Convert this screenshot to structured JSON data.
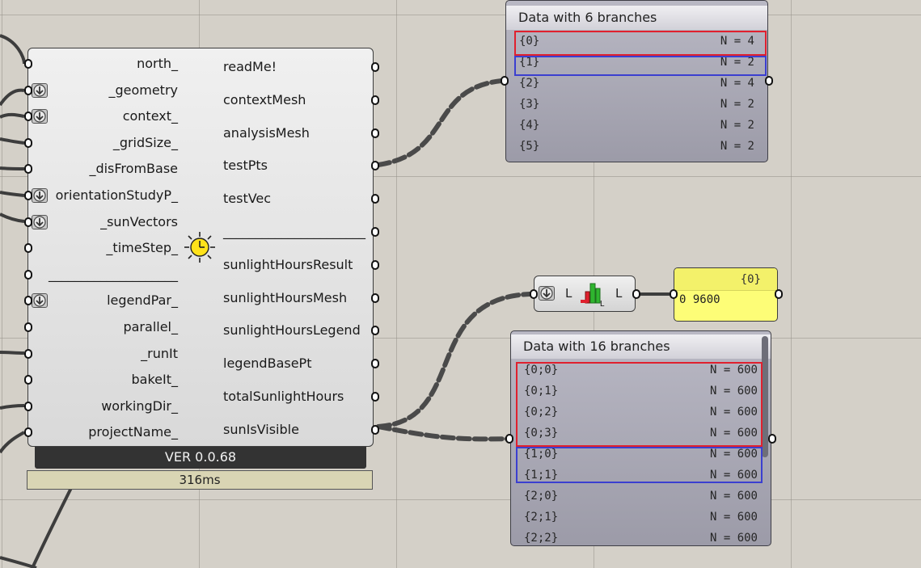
{
  "component": {
    "inputs": [
      {
        "label": "north_",
        "flatten": false
      },
      {
        "label": "_geometry",
        "flatten": true
      },
      {
        "label": "context_",
        "flatten": true
      },
      {
        "label": "_gridSize_",
        "flatten": false
      },
      {
        "label": "_disFromBase",
        "flatten": false
      },
      {
        "label": "orientationStudyP_",
        "flatten": true
      },
      {
        "label": "_sunVectors",
        "flatten": true
      },
      {
        "label": "_timeStep_",
        "flatten": false
      },
      {
        "label": "____________________",
        "flatten": false
      },
      {
        "label": "legendPar_",
        "flatten": true
      },
      {
        "label": "parallel_",
        "flatten": false
      },
      {
        "label": "_runIt",
        "flatten": false
      },
      {
        "label": "bakeIt_",
        "flatten": false
      },
      {
        "label": "workingDir_",
        "flatten": false
      },
      {
        "label": "projectName_",
        "flatten": false
      }
    ],
    "outputs": [
      "readMe!",
      "contextMesh",
      "analysisMesh",
      "testPts",
      "testVec",
      "______________________",
      "sunlightHoursResult",
      "sunlightHoursMesh",
      "sunlightHoursLegend",
      "legendBasePt",
      "totalSunlightHours",
      "sunIsVisible"
    ],
    "icon": "sun-clock-icon",
    "version": "VER 0.0.68",
    "runtime": "316ms"
  },
  "panel_top": {
    "title": "Data with 6 branches",
    "rows": [
      {
        "path": "{0}",
        "count": "N = 4"
      },
      {
        "path": "{1}",
        "count": "N = 2"
      },
      {
        "path": "{2}",
        "count": "N = 4"
      },
      {
        "path": "{3}",
        "count": "N = 2"
      },
      {
        "path": "{4}",
        "count": "N = 2"
      },
      {
        "path": "{5}",
        "count": "N = 2"
      }
    ]
  },
  "length_component": {
    "input_label": "L",
    "output_label": "L",
    "icon": "list-length-icon"
  },
  "panel_yellow": {
    "header": "{0}",
    "row": "0 9600"
  },
  "panel_bottom": {
    "title": "Data with 16 branches",
    "rows": [
      {
        "path": "{0;0}",
        "count": "N = 600"
      },
      {
        "path": "{0;1}",
        "count": "N = 600"
      },
      {
        "path": "{0;2}",
        "count": "N = 600"
      },
      {
        "path": "{0;3}",
        "count": "N = 600"
      },
      {
        "path": "{1;0}",
        "count": "N = 600"
      },
      {
        "path": "{1;1}",
        "count": "N = 600"
      },
      {
        "path": "{2;0}",
        "count": "N = 600"
      },
      {
        "path": "{2;1}",
        "count": "N = 600"
      },
      {
        "path": "{2;2}",
        "count": "N = 600"
      }
    ]
  },
  "colors": {
    "canvas": "#d4d0c8",
    "highlight_red": "#e0202e",
    "highlight_blue": "#3b3fd0",
    "yellow_panel": "#fdfd77"
  }
}
